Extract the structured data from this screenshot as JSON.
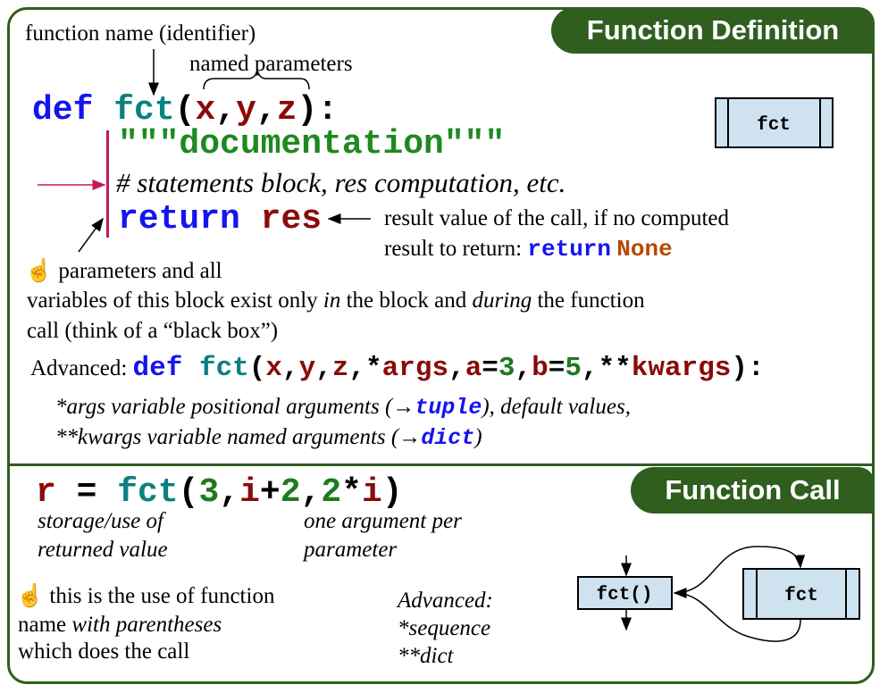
{
  "definition": {
    "title": "Function Definition",
    "label_function_name": "function name (identifier)",
    "label_named_parameters": "named parameters",
    "def_line": {
      "kw": "def",
      "name": "fct",
      "open": "(",
      "p1": "x",
      "c1": ",",
      "p2": "y",
      "c2": ",",
      "p3": "z",
      "close": "):"
    },
    "docstring": "\"\"\"documentation\"\"\"",
    "statements": "# statements block, res computation, etc.",
    "return_line": {
      "kw": "return",
      "value": "res"
    },
    "result_note_1": "result value of the call, if no computed",
    "result_note_2_text": "result to return: ",
    "result_note_2_kw": "return",
    "result_note_2_none": "None",
    "box_label": "fct",
    "scope_note": {
      "icon": "pointing-hand-icon",
      "hand": "☝",
      "line1": "parameters and all",
      "line2_a": "variables of this block exist only ",
      "line2_b": "in",
      "line2_c": " the block and ",
      "line2_d": "during",
      "line2_e": " the function",
      "line3": "call (think of a “black box”)"
    },
    "advanced": {
      "label": "Advanced: ",
      "kw": "def",
      "name": "fct",
      "open": "(",
      "p1": "x",
      "c1": ",",
      "p2": "y",
      "c2": ",",
      "p3": "z",
      "c3": ",",
      "star": "*",
      "args": "args",
      "c4": ",",
      "a": "a",
      "eq1": "=",
      "v1": "3",
      "c5": ",",
      "b": "b",
      "eq2": "=",
      "v2": "5",
      "c6": ",",
      "dstar": "**",
      "kwargs": "kwargs",
      "close": "):",
      "note1_a": "*args variable positional arguments (→",
      "note1_kw": "tuple",
      "note1_b": "), default values,",
      "note2_a": "**kwargs variable named arguments (→",
      "note2_kw": "dict",
      "note2_b": ")"
    }
  },
  "call": {
    "title": "Function Call",
    "code": {
      "r": "r",
      "eq": " = ",
      "name": "fct",
      "open": "(",
      "a1": "3",
      "c1": ",",
      "i1": "i",
      "plus": "+",
      "a2": "2",
      "c2": ",",
      "a3": "2",
      "mul": "*",
      "i2": "i",
      "close": ")"
    },
    "storage_1": "storage/use of",
    "storage_2": "returned value",
    "arg_1": "one argument per",
    "arg_2": "parameter",
    "note": {
      "hand": "☝",
      "line1": " this is the use of function",
      "line2_a": "name ",
      "line2_b": "with parentheses",
      "line3": "which does the call"
    },
    "advanced_1": "Advanced:",
    "advanced_2": "*sequence",
    "advanced_3": "**dict",
    "call_box_label": "fct()",
    "func_box_label": "fct"
  },
  "colors": {
    "frame": "#2f5e1e",
    "keyword": "#1414f0",
    "function": "#0a8080",
    "param": "#8b0a0a",
    "doc": "#1e8a1e",
    "none": "#b84a00",
    "box": "#cfe2f0",
    "block_bar": "#c2185b"
  }
}
